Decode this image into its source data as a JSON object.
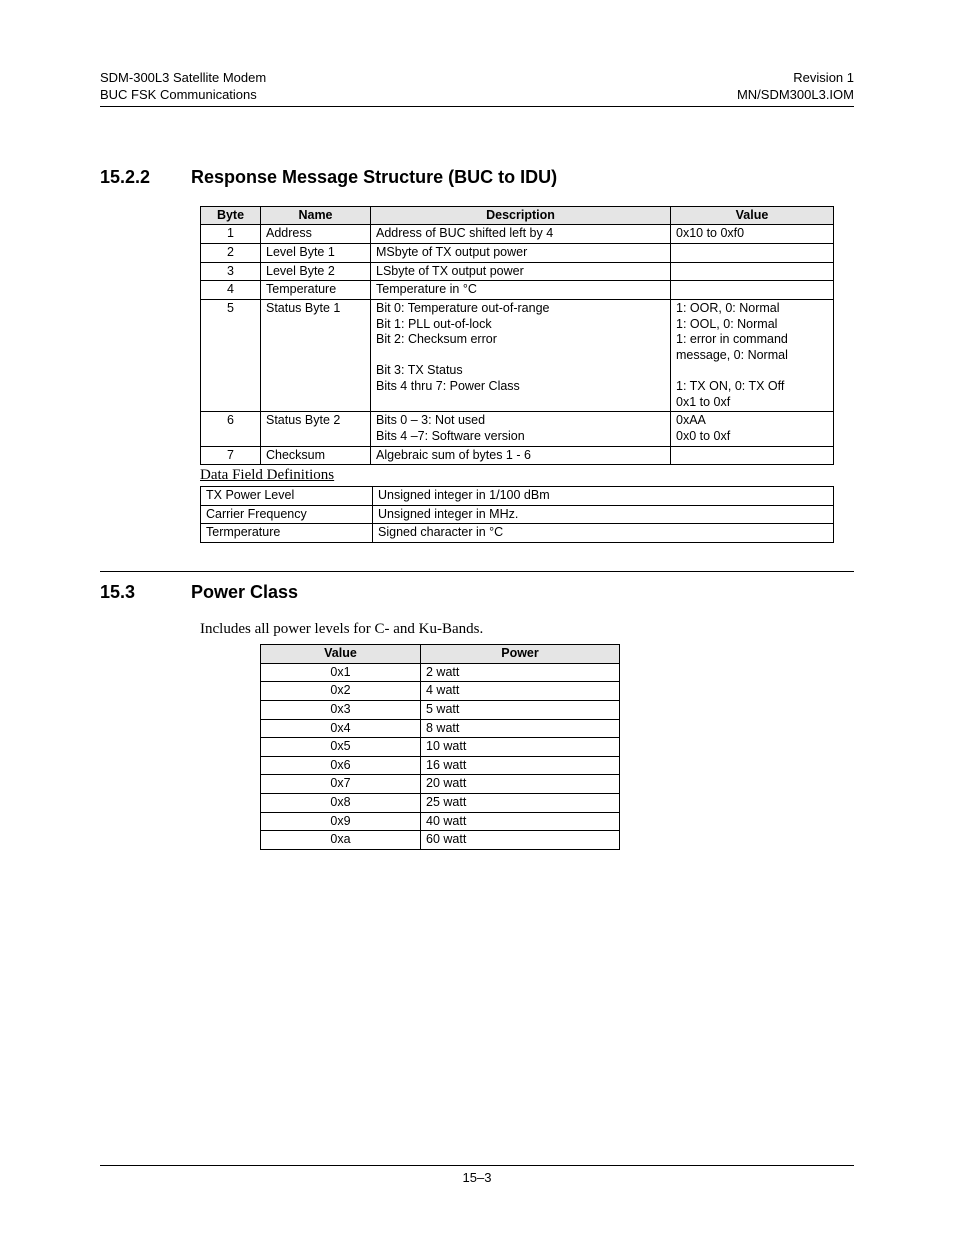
{
  "header": {
    "left1": "SDM-300L3 Satellite Modem",
    "left2": "BUC FSK Communications",
    "right1": "Revision 1",
    "right2": "MN/SDM300L3.IOM"
  },
  "sec1": {
    "num": "15.2.2",
    "title": "Response Message Structure (BUC to IDU)",
    "cols": {
      "c1": "Byte",
      "c2": "Name",
      "c3": "Description",
      "c4": "Value"
    },
    "rows": [
      {
        "b": "1",
        "n": "Address",
        "d": "Address of BUC shifted left by 4",
        "v": "0x10 to 0xf0"
      },
      {
        "b": "2",
        "n": "Level Byte 1",
        "d": "MSbyte of TX output power",
        "v": ""
      },
      {
        "b": "3",
        "n": "Level Byte 2",
        "d": "LSbyte of TX output power",
        "v": ""
      },
      {
        "b": "4",
        "n": "Temperature",
        "d": "Temperature in °C",
        "v": ""
      },
      {
        "b": "5",
        "n": "Status Byte 1",
        "d": "Bit 0: Temperature out-of-range\nBit 1: PLL out-of-lock\nBit 2: Checksum error\n\nBit 3: TX Status\nBits 4 thru 7: Power Class",
        "v": "1: OOR, 0: Normal\n1: OOL,  0: Normal\n1: error in command message, 0: Normal\n\n1: TX ON, 0: TX Off\n0x1 to 0xf"
      },
      {
        "b": "6",
        "n": "Status Byte 2",
        "d": "Bits 0 – 3: Not used\nBits 4 –7: Software version",
        "v": "0xAA\n0x0 to 0xf"
      },
      {
        "b": "7",
        "n": "Checksum",
        "d": "Algebraic sum of bytes 1 - 6",
        "v": ""
      }
    ],
    "subhead": "Data Field Definitions",
    "defs": [
      {
        "k": "TX Power Level",
        "v": "Unsigned integer in 1/100 dBm"
      },
      {
        "k": "Carrier Frequency",
        "v": "Unsigned integer in MHz."
      },
      {
        "k": "Termperature",
        "v": "Signed character in °C"
      }
    ]
  },
  "sec2": {
    "num": "15.3",
    "title": "Power Class",
    "intro": "Includes all power levels for C- and Ku-Bands.",
    "cols": {
      "c1": "Value",
      "c2": "Power"
    },
    "rows": [
      {
        "v": "0x1",
        "p": "2 watt"
      },
      {
        "v": "0x2",
        "p": "4 watt"
      },
      {
        "v": "0x3",
        "p": "5 watt"
      },
      {
        "v": "0x4",
        "p": "8 watt"
      },
      {
        "v": "0x5",
        "p": "10 watt"
      },
      {
        "v": "0x6",
        "p": "16 watt"
      },
      {
        "v": "0x7",
        "p": "20 watt"
      },
      {
        "v": "0x8",
        "p": "25 watt"
      },
      {
        "v": "0x9",
        "p": "40 watt"
      },
      {
        "v": "0xa",
        "p": "60 watt"
      }
    ]
  },
  "footer": {
    "page": "15–3"
  }
}
